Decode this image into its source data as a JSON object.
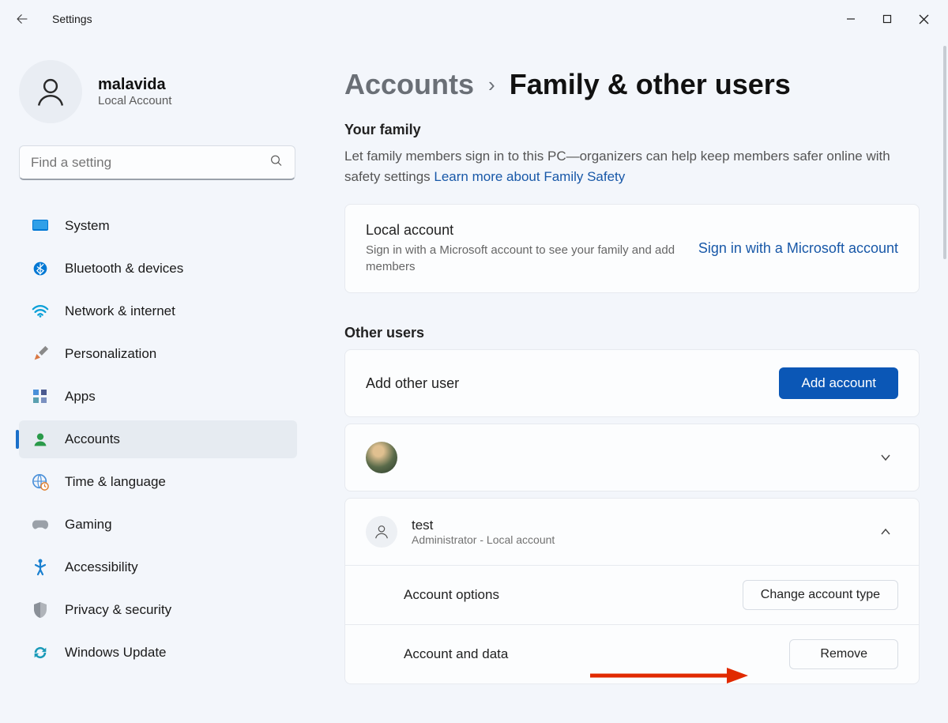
{
  "window": {
    "app_title": "Settings"
  },
  "user": {
    "name": "malavida",
    "subtitle": "Local Account"
  },
  "search": {
    "placeholder": "Find a setting"
  },
  "nav": {
    "system": "System",
    "bluetooth": "Bluetooth & devices",
    "network": "Network & internet",
    "personalization": "Personalization",
    "apps": "Apps",
    "accounts": "Accounts",
    "time": "Time & language",
    "gaming": "Gaming",
    "accessibility": "Accessibility",
    "privacy": "Privacy & security",
    "update": "Windows Update"
  },
  "breadcrumb": {
    "parent": "Accounts",
    "current": "Family & other users"
  },
  "family": {
    "section_title": "Your family",
    "description": "Let family members sign in to this PC—organizers can help keep members safer online with safety settings  ",
    "learn_more": "Learn more about Family Safety",
    "card_title": "Local account",
    "card_sub": "Sign in with a Microsoft account to see your family and add members",
    "signin_link": "Sign in with a Microsoft account"
  },
  "other": {
    "section_title": "Other users",
    "add_label": "Add other user",
    "add_button": "Add account",
    "user1_name": "",
    "user2_name": "test",
    "user2_sub": "Administrator - Local account",
    "account_options": "Account options",
    "change_type": "Change account type",
    "account_data": "Account and data",
    "remove": "Remove"
  }
}
